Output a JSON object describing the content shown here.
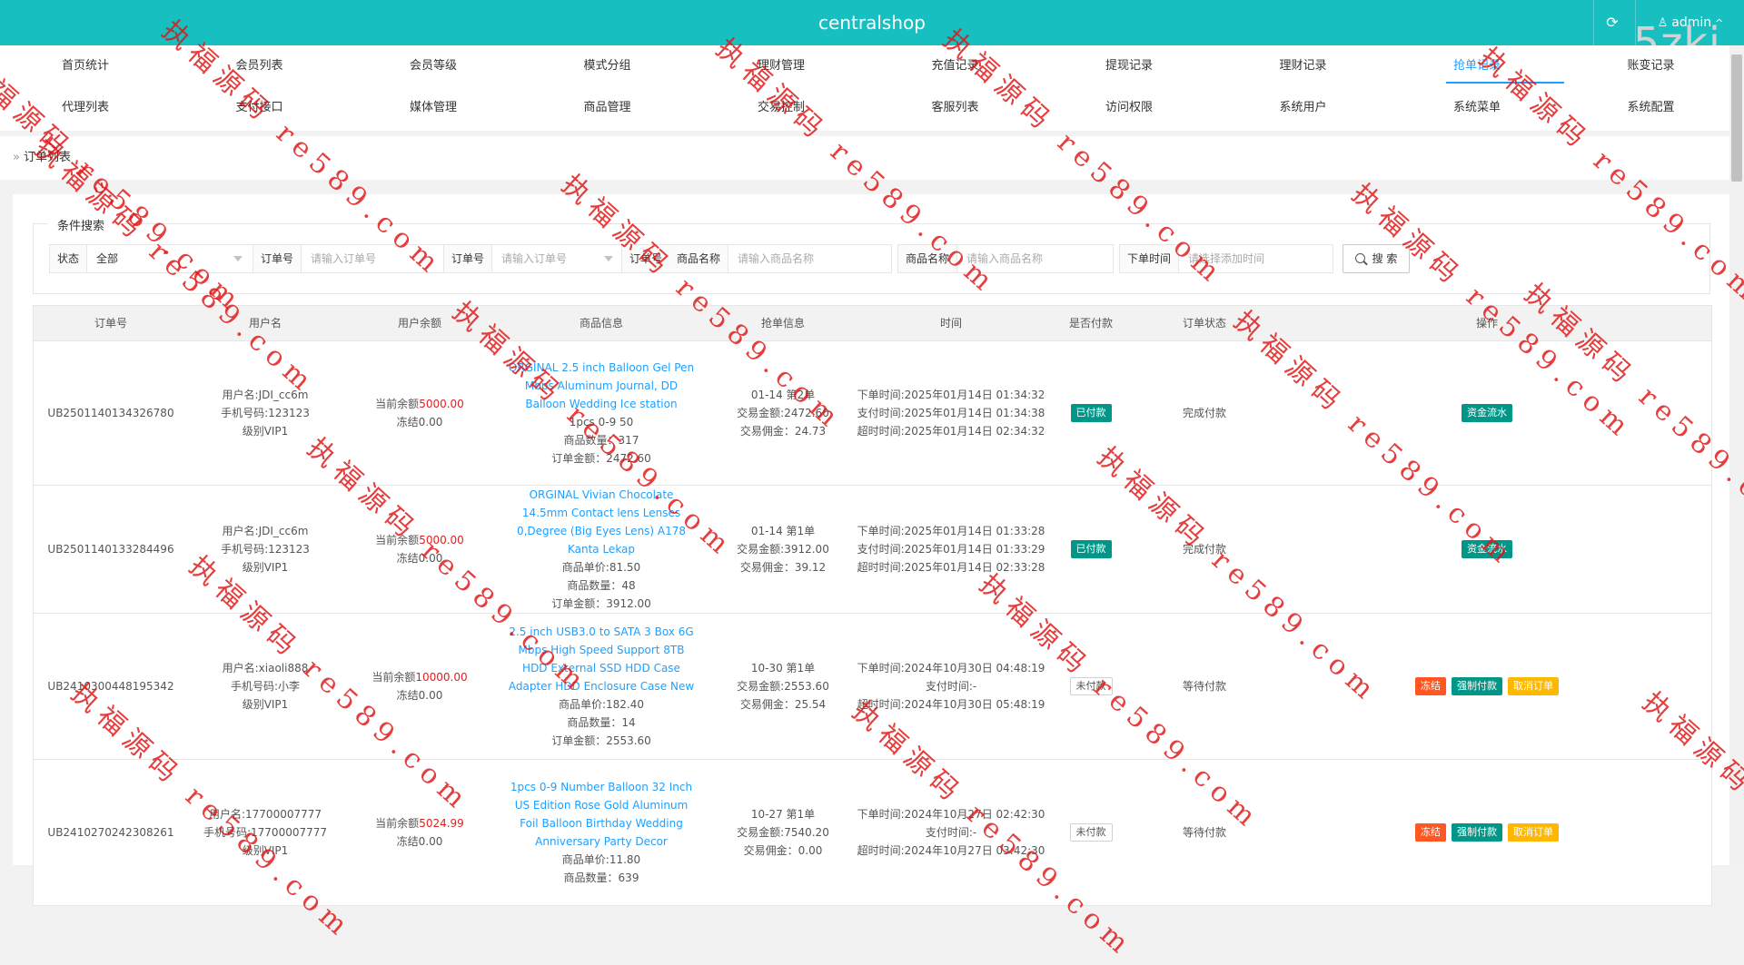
{
  "header": {
    "brand": "centralshop",
    "refresh_glyph": "⟳",
    "admin_label": "admin",
    "user_icon": "user-icon",
    "caret": "^",
    "corner_mark": "5zki"
  },
  "nav": {
    "row1": [
      "首页统计",
      "会员列表",
      "会员等级",
      "模式分组",
      "理财管理",
      "充值记录",
      "提现记录",
      "理财记录",
      "抢单记录",
      "账变记录"
    ],
    "row2": [
      "代理列表",
      "支付接口",
      "媒体管理",
      "商品管理",
      "交易控制",
      "客服列表",
      "访问权限",
      "系统用户",
      "系统菜单",
      "系统配置"
    ],
    "active": "抢单记录"
  },
  "breadcrumb": {
    "arrow": "»",
    "title": "订单列表"
  },
  "search": {
    "legend": "条件搜索",
    "status_label": "状态",
    "status_value": "全部",
    "order_label": "订单号",
    "order_placeholder": "请输入订单号",
    "order2_label": "订单号",
    "order2_placeholder": "请输入订单号",
    "order3_label": "订单号",
    "product_label": "商品名称",
    "product_placeholder": "请输入商品名称",
    "product2_label": "商品名称",
    "product2_placeholder": "请输入商品名称",
    "time_label": "下单时间",
    "time_placeholder": "请选择添加时间",
    "button_label": "搜 索"
  },
  "table": {
    "columns": [
      "订单号",
      "用户名",
      "用户余额",
      "商品信息",
      "抢单信息",
      "时间",
      "是否付款",
      "订单状态",
      "操作"
    ],
    "rows": [
      {
        "order_no": "UB2501140134326780",
        "user": [
          "用户名:JDI_cc6m",
          "手机号码:123123",
          "级别VIP1"
        ],
        "balance_label": "当前余额",
        "balance_value": "5000.00",
        "frozen": "冻结0.00",
        "product_name": "ORGINAL 2.5 inch Balloon Gel Pen Mbps Aluminum Journal, DD Balloon Wedding Ice station",
        "product_lines": [
          "1pcs 0-9 50",
          "商品数量：317",
          "订单金额：2472.60"
        ],
        "grab": [
          "01-14 第2单",
          "交易金额:2472.60",
          "交易佣金：24.73"
        ],
        "times": [
          "下单时间:2025年01月14日 01:34:32",
          "支付时间:2025年01月14日 01:34:38",
          "超时时间:2025年01月14日 02:34:32"
        ],
        "pay": "已付款",
        "state": "完成付款",
        "actions": [
          "资金流水"
        ]
      },
      {
        "order_no": "UB2501140133284496",
        "user": [
          "用户名:JDI_cc6m",
          "手机号码:123123",
          "级别VIP1"
        ],
        "balance_label": "当前余额",
        "balance_value": "5000.00",
        "frozen": "冻结0.00",
        "product_name": "ORGINAL Vivian Chocolate 14.5mm Contact lens Lenses 0,Degree (Big Eyes Lens) A178 Kanta Lekap",
        "product_lines": [
          "商品单价:81.50",
          "商品数量：48",
          "订单金额：3912.00"
        ],
        "grab": [
          "01-14 第1单",
          "交易金额:3912.00",
          "交易佣金：39.12"
        ],
        "times": [
          "下单时间:2025年01月14日 01:33:28",
          "支付时间:2025年01月14日 01:33:29",
          "超时时间:2025年01月14日 02:33:28"
        ],
        "pay": "已付款",
        "state": "完成付款",
        "actions": [
          "资金流水"
        ]
      },
      {
        "order_no": "UB2410300448195342",
        "user": [
          "用户名:xiaoli888",
          "手机号码:小李",
          "级别VIP1"
        ],
        "balance_label": "当前余额",
        "balance_value": "10000.00",
        "frozen": "冻结0.00",
        "product_name": "2.5 inch USB3.0 to SATA 3 Box 6G Mbps High Speed Support 8TB HDD External SSD HDD Case Adapter HDD Enclosure Case New",
        "product_lines": [
          "商品单价:182.40",
          "商品数量：14",
          "订单金额：2553.60"
        ],
        "grab": [
          "10-30 第1单",
          "交易金额:2553.60",
          "交易佣金：25.54"
        ],
        "times": [
          "下单时间:2024年10月30日 04:48:19",
          "支付时间:-",
          "超时时间:2024年10月30日 05:48:19"
        ],
        "pay": "未付款",
        "state": "等待付款",
        "actions": [
          "冻结",
          "强制付款",
          "取消订单"
        ]
      },
      {
        "order_no": "UB2410270242308261",
        "user": [
          "用户名:17700007777",
          "手机号码:17700007777",
          "级别VIP1"
        ],
        "balance_label": "当前余额",
        "balance_value": "5024.99",
        "frozen": "冻结0.00",
        "product_name": "1pcs 0-9 Number Balloon 32 Inch US Edition Rose Gold Aluminum Foil Balloon Birthday Wedding Anniversary Party Decor",
        "product_lines": [
          "商品单价:11.80",
          "商品数量：639"
        ],
        "grab": [
          "10-27 第1单",
          "交易金额:7540.20",
          "交易佣金：0.00"
        ],
        "times": [
          "下单时间:2024年10月27日 02:42:30",
          "支付时间:-",
          "超时时间:2024年10月27日 03:42:30"
        ],
        "pay": "未付款",
        "state": "等待付款",
        "actions": [
          "冻结",
          "强制付款",
          "取消订单"
        ]
      }
    ]
  },
  "watermark": {
    "text": "执福源码 re589.com",
    "color": "#de1414"
  }
}
